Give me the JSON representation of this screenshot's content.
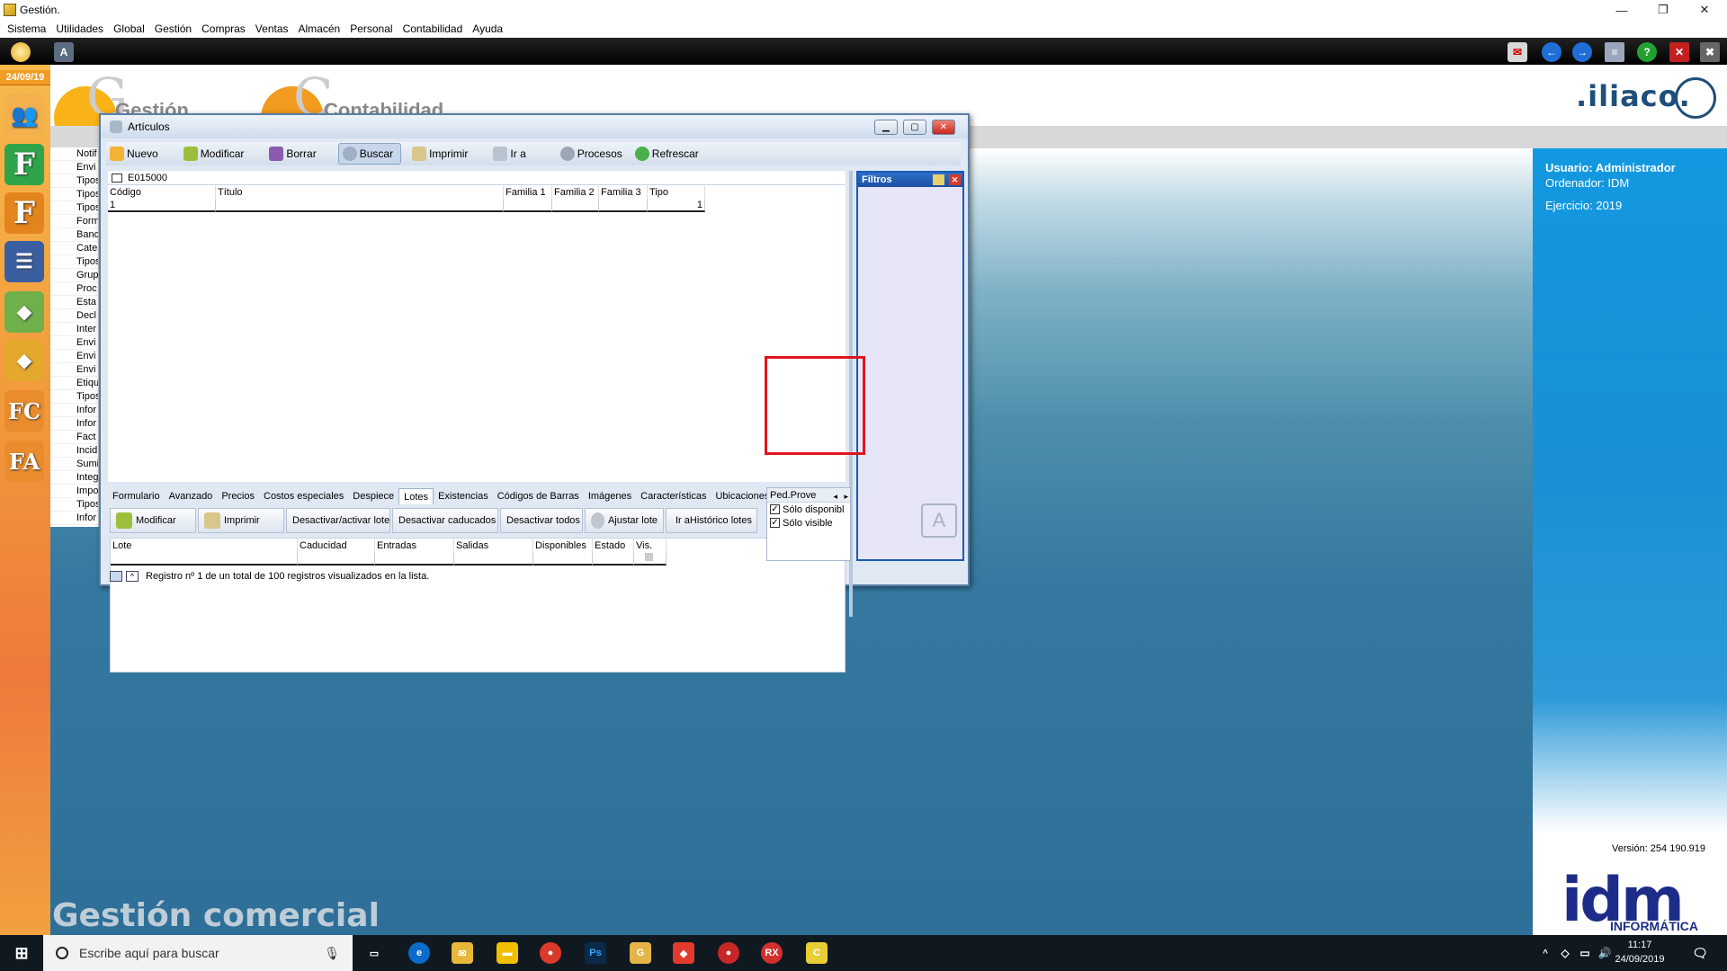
{
  "window_title": "Gestión.",
  "menu": [
    "Sistema",
    "Utilidades",
    "Global",
    "Gestión",
    "Compras",
    "Ventas",
    "Almacén",
    "Personal",
    "Contabilidad",
    "Ayuda"
  ],
  "date_badge": "24/09/19",
  "left_list": [
    "Notif",
    "Envi",
    "Tipos",
    "Tipos",
    "Tipos",
    "Form",
    "Banc",
    "Cate",
    "Tipos",
    "Grup",
    "Proc",
    "Esta",
    "Decl",
    "Inter",
    "Envi",
    "Envi",
    "Envi",
    "Etiqu",
    "Tipos",
    "Infor",
    "Infor",
    "Fact",
    "Incid",
    "Sumi",
    "Integ",
    "Impo",
    "Tipos",
    "Infor"
  ],
  "header": {
    "logo_gestion": "Gestión",
    "logo_contabilidad": "Contabilidad",
    "brand": ".iliaco."
  },
  "info": {
    "usuario": "Usuario: Administrador",
    "ordenador": "Ordenador: IDM",
    "ejercicio": "Ejercicio: 2019",
    "version": "Versión: 254 190.919",
    "idm": "idm",
    "idm_sub": "INFORMÁTICA"
  },
  "desk_title": "Gestión comercial",
  "articulos": {
    "title": "Artículos",
    "toolbar": [
      "Nuevo",
      "Modificar",
      "Borrar",
      "Buscar",
      "Imprimir",
      "Ir a",
      "Procesos",
      "Refrescar"
    ],
    "code": "E015000",
    "grid_headers": [
      "Código",
      "Título",
      "Familia 1",
      "Familia 2",
      "Familia 3",
      "Tipo"
    ],
    "grid_row": {
      "codigo": "1",
      "tipo": "1"
    },
    "filtros_title": "Filtros",
    "tabs": [
      "Formulario",
      "Avanzado",
      "Precios",
      "Costos especiales",
      "Despiece",
      "Lotes",
      "Existencias",
      "Códigos de Barras",
      "Imágenes",
      "Características",
      "Ubicaciones"
    ],
    "selected_tab": "Lotes",
    "popup_tab": "Ped.Prove",
    "checks": [
      "Sólo disponibl",
      "Sólo visible"
    ],
    "lot_buttons": [
      "Modificar",
      "Imprimir",
      "Desactivar/activar lote",
      "Desactivar caducados",
      "Desactivar todos",
      "Ajustar lote",
      "Ir aHistórico lotes"
    ],
    "lot_headers": [
      "Lote",
      "Caducidad",
      "Entradas",
      "Salidas",
      "Disponibles",
      "Estado",
      "Vis."
    ],
    "status": "Registro nº 1 de un total de 100 registros visualizados en la lista."
  },
  "taskbar": {
    "search_placeholder": "Escribe aquí para buscar",
    "time": "11:17",
    "date": "24/09/2019"
  }
}
